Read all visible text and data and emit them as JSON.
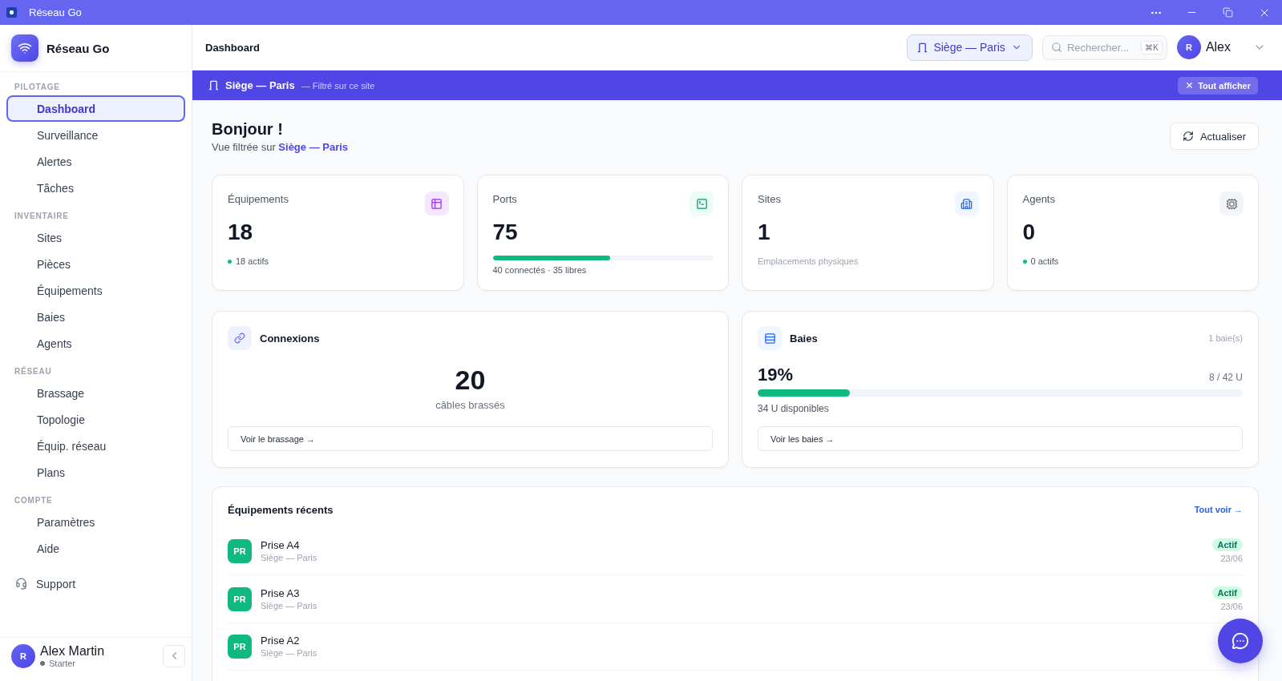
{
  "window": {
    "title": "Réseau Go"
  },
  "sidebar": {
    "brand": "Réseau Go",
    "sections": [
      {
        "label": "PILOTAGE",
        "items": [
          {
            "label": "Dashboard",
            "selected": true
          },
          {
            "label": "Surveillance",
            "selected": false
          },
          {
            "label": "Alertes",
            "selected": false
          },
          {
            "label": "Tâches",
            "selected": false
          }
        ]
      },
      {
        "label": "INVENTAIRE",
        "items": [
          {
            "label": "Sites",
            "selected": false
          },
          {
            "label": "Pièces",
            "selected": false
          },
          {
            "label": "Équipements",
            "selected": false
          },
          {
            "label": "Baies",
            "selected": false
          },
          {
            "label": "Agents",
            "selected": false
          }
        ]
      },
      {
        "label": "RÉSEAU",
        "items": [
          {
            "label": "Brassage",
            "selected": false
          },
          {
            "label": "Topologie",
            "selected": false
          },
          {
            "label": "Équip. réseau",
            "selected": false
          },
          {
            "label": "Plans",
            "selected": false
          }
        ]
      },
      {
        "label": "COMPTE",
        "items": [
          {
            "label": "Paramètres",
            "selected": false
          },
          {
            "label": "Aide",
            "selected": false
          }
        ]
      }
    ],
    "support": "Support",
    "user": {
      "initial": "R",
      "name": "Alex Martin",
      "plan": "Starter"
    }
  },
  "header": {
    "title": "Dashboard",
    "site_selector": "Siège — Paris",
    "search": {
      "placeholder": "Rechercher...",
      "shortcut": "⌘K"
    },
    "user": {
      "initial": "R",
      "name": "Alex"
    }
  },
  "filter_banner": {
    "site": "Siège — Paris",
    "note": "— Filtré sur ce site",
    "clear_button": "Tout afficher"
  },
  "greeting": {
    "title": "Bonjour !",
    "subtitle": "Vue filtrée sur **Siège — Paris**",
    "refresh_button": "Actualiser"
  },
  "stats": [
    {
      "kind": "dot",
      "label": "Équipements",
      "value": "18",
      "note": "18 actifs"
    },
    {
      "kind": "progress",
      "label": "Ports",
      "value": "75",
      "level": 0.53,
      "note": "40 connectés · 35 libres"
    },
    {
      "kind": "plain",
      "label": "Sites",
      "value": "1",
      "note": "Emplacements physiques"
    },
    {
      "kind": "dot",
      "label": "Agents",
      "value": "0",
      "note": "0 actifs"
    }
  ],
  "panels": {
    "connections": {
      "title": "Connexions",
      "value": "20",
      "caption": "câbles brassés",
      "link": "Voir le brassage →"
    },
    "racks": {
      "title": "Baies",
      "count": "1 baie(s)",
      "percent": "19%",
      "usage": "8 / 42 U",
      "level": 0.19,
      "available": "34 U disponibles",
      "link": "Voir les baies →"
    }
  },
  "recent": {
    "title": "Équipements récents",
    "see_all": "Tout voir →",
    "rows": [
      {
        "initials": "PR",
        "name": "Prise A4",
        "location": "Siège — Paris",
        "status": "Actif",
        "date": "23/06"
      },
      {
        "initials": "PR",
        "name": "Prise A3",
        "location": "Siège — Paris",
        "status": "Actif",
        "date": "23/06"
      },
      {
        "initials": "PR",
        "name": "Prise A2",
        "location": "Siège — Paris"
      }
    ]
  }
}
